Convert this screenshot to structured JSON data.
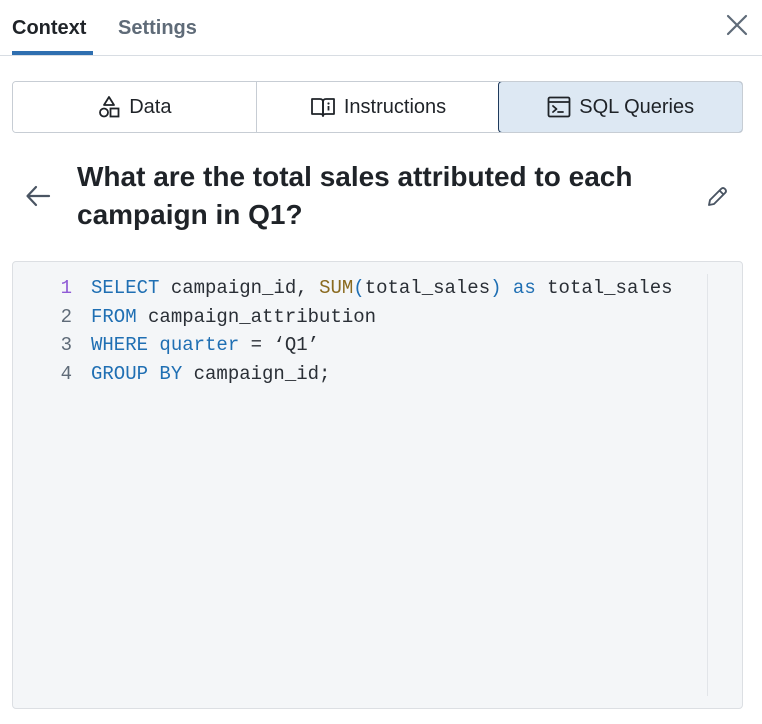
{
  "tabs": [
    {
      "label": "Context",
      "active": true
    },
    {
      "label": "Settings",
      "active": false
    }
  ],
  "segments": [
    {
      "label": "Data",
      "icon": "shapes-icon",
      "active": false
    },
    {
      "label": "Instructions",
      "icon": "book-info-icon",
      "active": false
    },
    {
      "label": "SQL Queries",
      "icon": "terminal-icon",
      "active": true
    }
  ],
  "question": "What are the total sales attributed to each campaign in Q1?",
  "code": {
    "lines": [
      {
        "number": "1",
        "tokens": [
          {
            "text": "SELECT",
            "kind": "kw"
          },
          {
            "text": " campaign_id, ",
            "kind": "id"
          },
          {
            "text": "SUM",
            "kind": "fn"
          },
          {
            "text": "(",
            "kind": "kw"
          },
          {
            "text": "total_sales",
            "kind": "id"
          },
          {
            "text": ")",
            "kind": "kw"
          },
          {
            "text": " ",
            "kind": "id"
          },
          {
            "text": "as",
            "kind": "kw"
          },
          {
            "text": " total_sales",
            "kind": "id"
          }
        ]
      },
      {
        "number": "2",
        "tokens": [
          {
            "text": "FROM",
            "kind": "kw"
          },
          {
            "text": " campaign_attribution",
            "kind": "id"
          }
        ]
      },
      {
        "number": "3",
        "tokens": [
          {
            "text": "WHERE",
            "kind": "kw"
          },
          {
            "text": " ",
            "kind": "id"
          },
          {
            "text": "quarter",
            "kind": "kw"
          },
          {
            "text": " = ‘Q1’",
            "kind": "id"
          }
        ]
      },
      {
        "number": "4",
        "tokens": [
          {
            "text": "GROUP BY",
            "kind": "kw"
          },
          {
            "text": " campaign_id;",
            "kind": "id"
          }
        ]
      }
    ]
  },
  "colors": {
    "accent": "#2f6fb0",
    "active_segment_bg": "#dde8f3",
    "keyword": "#1f6fb3",
    "function": "#8a6a1f",
    "code_bg": "#f4f6f8"
  },
  "icons": {
    "close": "close-icon",
    "back": "arrow-left-icon",
    "edit": "pencil-icon"
  }
}
